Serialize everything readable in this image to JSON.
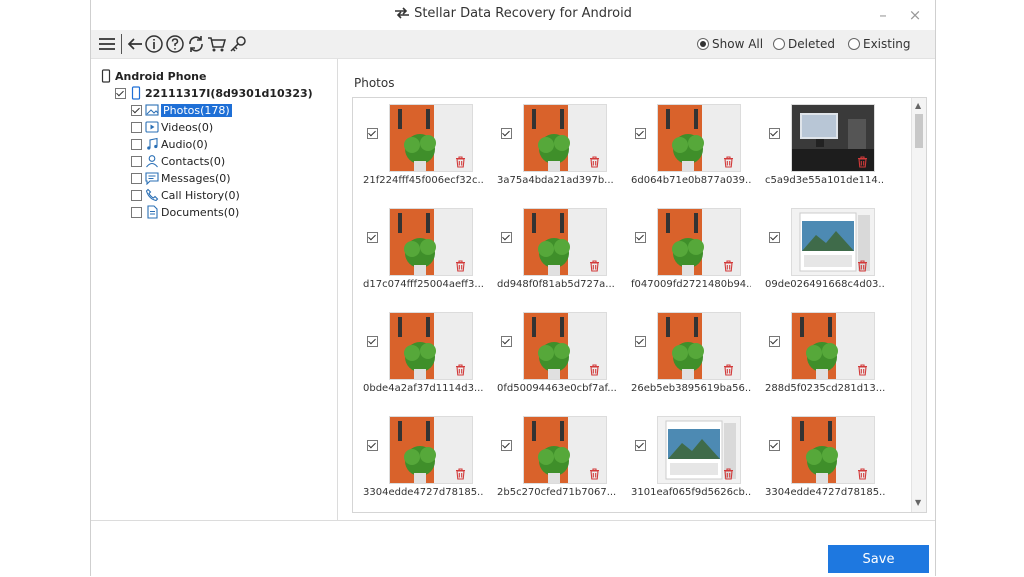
{
  "window": {
    "title": "Stellar Data Recovery for Android",
    "minimize": "–",
    "close": "×"
  },
  "toolbar": {
    "icons": [
      "menu-icon",
      "back-icon",
      "info-icon",
      "help-icon",
      "refresh-icon",
      "cart-icon",
      "key-icon"
    ],
    "filters": [
      {
        "label": "Show All",
        "selected": true
      },
      {
        "label": "Deleted",
        "selected": false
      },
      {
        "label": "Existing",
        "selected": false
      }
    ]
  },
  "tree": {
    "root": "Android Phone",
    "device": "22111317I(8d9301d10323)",
    "items": [
      {
        "label": "Photos(178)",
        "checked": true,
        "selected": true,
        "icon": "photo-icon"
      },
      {
        "label": "Videos(0)",
        "checked": false,
        "icon": "video-icon"
      },
      {
        "label": "Audio(0)",
        "checked": false,
        "icon": "audio-icon"
      },
      {
        "label": "Contacts(0)",
        "checked": false,
        "icon": "contact-icon"
      },
      {
        "label": "Messages(0)",
        "checked": false,
        "icon": "message-icon"
      },
      {
        "label": "Call History(0)",
        "checked": false,
        "icon": "call-history-icon"
      },
      {
        "label": "Documents(0)",
        "checked": false,
        "icon": "document-icon"
      }
    ]
  },
  "panel": {
    "title": "Photos",
    "photos": [
      {
        "name": "21f224fff45f006ecf32c...",
        "image": "plant"
      },
      {
        "name": "3a75a4bda21ad397b...",
        "image": "plant"
      },
      {
        "name": "6d064b71e0b877a039...",
        "image": "plant"
      },
      {
        "name": "c5a9d3e55a101de114...",
        "image": "computer"
      },
      {
        "name": "d17c074fff25004aeff3...",
        "image": "plant"
      },
      {
        "name": "dd948f0f81ab5d727a...",
        "image": "plant"
      },
      {
        "name": "f047009fd2721480b94...",
        "image": "plant"
      },
      {
        "name": "09de026491668c4d03...",
        "image": "calendar"
      },
      {
        "name": "0bde4a2af37d1114d3...",
        "image": "plant"
      },
      {
        "name": "0fd50094463e0cbf7af...",
        "image": "plant"
      },
      {
        "name": "26eb5eb3895619ba56...",
        "image": "plant"
      },
      {
        "name": "288d5f0235cd281d13...",
        "image": "plant"
      },
      {
        "name": "3304edde4727d78185...",
        "image": "plant"
      },
      {
        "name": "2b5c270cfed71b7067...",
        "image": "plant"
      },
      {
        "name": "3101eaf065f9d5626cb...",
        "image": "calendar2"
      },
      {
        "name": "3304edde4727d78185...",
        "image": "plant"
      }
    ]
  },
  "footer": {
    "save_label": "Save"
  },
  "colors": {
    "accent": "#1e78e0",
    "selection": "#1e6fd6",
    "delete": "#d23a3a",
    "plant_wall": "#d9622b",
    "leaf": "#3f8f2a"
  }
}
